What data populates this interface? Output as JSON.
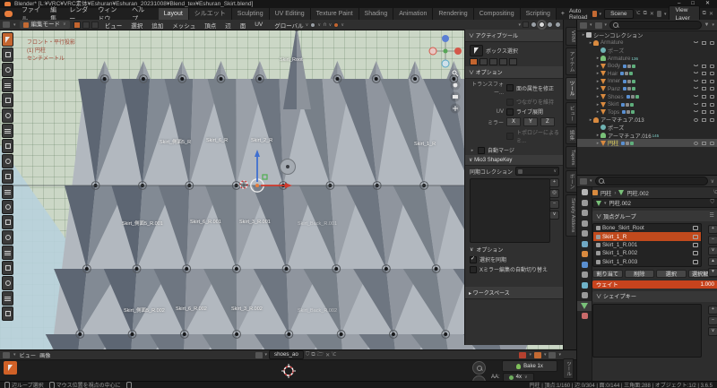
{
  "titlebar": {
    "title": "Blender* [L:¥VRC¥VRC素体¥Eshuran¥Eshuran_20231008¥Blend_tex¥Eshuran_Skirt.blend]",
    "minimize": "–",
    "maximize": "□",
    "close": "✕"
  },
  "topbar": {
    "menus": [
      "ファイル",
      "編集",
      "レンダー",
      "ウィンドウ",
      "ヘルプ"
    ],
    "workspaces": [
      "Layout",
      "シルエット",
      "Sculpting",
      "UV Editing",
      "Texture Paint",
      "Shading",
      "Animation",
      "Rendering",
      "Compositing",
      "Scripting"
    ],
    "active_workspace": "Layout",
    "add_tab": "+",
    "auto_reload": "Auto Reload",
    "scene_label": "Scene",
    "view_layer_label": "View Layer"
  },
  "viewport": {
    "header": {
      "mode": "編集モード",
      "menus": [
        "ビュー",
        "選択",
        "追加",
        "メッシュ",
        "頂点",
        "辺",
        "面",
        "UV"
      ],
      "orientation": "グローバル"
    },
    "overlay": {
      "projection": "フロント・平行投影",
      "object": "(1) 円柱",
      "units": "センチメートル"
    },
    "bone_labels": {
      "root": "Skirt_Root",
      "row1": [
        "Skirt_側面5_R",
        "Skirt_6_R",
        "Skirt_2_R",
        "Skirt_1_R"
      ],
      "row2": [
        "Skirt_側面5_R.001",
        "Skirt_6_R.001",
        "Skirt_3_R.001",
        "Skirt_Back_R.001"
      ],
      "row3": [
        "Skirt_側面5_R.002",
        "Skirt_6_R.002",
        "Skirt_3_R.002",
        "Skirt_Back_R.002"
      ]
    }
  },
  "npanel": {
    "tabs": [
      "VRM",
      "アイテム",
      "ツール",
      "ビュー",
      "編集",
      "Tapers",
      "ボーン",
      "Simply Addons"
    ],
    "active_tab": "ツール",
    "active_tool": {
      "title": "アクティブツール",
      "tool_name": "ボックス選択"
    },
    "options": {
      "title": "オプション",
      "transform_label": "トランスフォー...",
      "correct_face": "面の属性を修正",
      "correct_face_checked": false,
      "keep_connected": "つながりを維持",
      "keep_connected_checked": false,
      "uv_label": "UV",
      "live_unwrap": "ライブ展開",
      "live_unwrap_checked": false,
      "mirror_label": "ミラー",
      "mirror_axes": [
        "X",
        "Y",
        "Z"
      ],
      "topology_mirror": "トポロジーによるミ...",
      "auto_merge": "自動マージ"
    },
    "mio3": {
      "title": "Mio3 ShapeKey",
      "sync_collection": "同期コレクション",
      "options_title": "オプション",
      "sync_selection": "選択を同期",
      "sync_selection_checked": true,
      "xmirror": "Xミラー編集の自動切り替え",
      "xmirror_checked": false
    },
    "workspace_title": "ワークスペース"
  },
  "outliner": {
    "rows": [
      {
        "name": "シーンコレクション",
        "icon": "collection",
        "level": 0,
        "expand": true
      },
      {
        "name": "Armature",
        "icon": "armature",
        "level": 1,
        "dim": true,
        "expand": true,
        "vis": "closed"
      },
      {
        "name": "ポーズ",
        "icon": "pose",
        "level": 2,
        "dim": true
      },
      {
        "name": "Armature",
        "icon": "armdata",
        "level": 2,
        "dim": true,
        "expand": true,
        "badge": "136"
      },
      {
        "name": "Body",
        "icon": "mesh",
        "level": 2,
        "dim": true,
        "expand": true,
        "vis": "closed",
        "mods": true
      },
      {
        "name": "Hair",
        "icon": "mesh",
        "level": 2,
        "dim": true,
        "expand": true,
        "vis": "closed",
        "mods": true
      },
      {
        "name": "Inner",
        "icon": "mesh",
        "level": 2,
        "dim": true,
        "expand": true,
        "vis": "closed",
        "mods": true
      },
      {
        "name": "Panz",
        "icon": "mesh",
        "level": 2,
        "dim": true,
        "expand": true,
        "vis": "closed",
        "mods": true
      },
      {
        "name": "Shoes",
        "icon": "mesh",
        "level": 2,
        "dim": true,
        "expand": true,
        "vis": "closed",
        "mods": true
      },
      {
        "name": "Skirt",
        "icon": "mesh",
        "level": 2,
        "dim": true,
        "expand": true,
        "vis": "closed",
        "mods": true
      },
      {
        "name": "Tops",
        "icon": "mesh",
        "level": 2,
        "dim": true,
        "expand": true,
        "vis": "closed",
        "mods": true
      },
      {
        "name": "アーマチュア.013",
        "icon": "armature",
        "level": 1,
        "expand": true,
        "vis": "open"
      },
      {
        "name": "ポーズ",
        "icon": "pose",
        "level": 2
      },
      {
        "name": "アーマチュア.016",
        "icon": "armdata",
        "level": 2,
        "expand": true,
        "badge": "145"
      },
      {
        "name": "円柱",
        "icon": "mesh",
        "level": 2,
        "active": true,
        "expand": true,
        "vis": "open",
        "mods": true
      }
    ]
  },
  "properties": {
    "breadcrumb": {
      "object": "円柱",
      "separator": "›",
      "data": "円柱.002"
    },
    "datablock": "円柱.002",
    "vertex_groups": {
      "title": "頂点グループ",
      "items": [
        "Bone_Skirt_Root",
        "Skirt_1_R",
        "Skirt_1_R.001",
        "Skirt_1_R.002",
        "Skirt_1_R.003"
      ],
      "selected": "Skirt_1_R",
      "buttons": [
        "割り当て",
        "削除",
        "選択",
        "選択解除"
      ],
      "weight_label": "ウェイト",
      "weight_value": "1.000"
    },
    "shape_keys_title": "シェイプキー"
  },
  "image_editor": {
    "menus": [
      "ビュー",
      "画像"
    ],
    "image_name": "shoes_ao",
    "bake_button": "Bake 1x",
    "aa_label": "AA:",
    "aa_value": "4x",
    "tool_tab": "ツール"
  },
  "statusbar": {
    "hint1": "辺ループ選択",
    "hint2": "マウス位置を視点の中心に",
    "right": "円柱 | 頂点:1/160 | 辺:0/304 | 面:0/144 | 三角面:288 | オブジェクト:1/2 | 3.6.5"
  },
  "colors": {
    "accent": "#c4652f",
    "selection": "#c14a1d",
    "active_text": "#e3d25f",
    "viewport_bg": "#cbd7c6"
  }
}
